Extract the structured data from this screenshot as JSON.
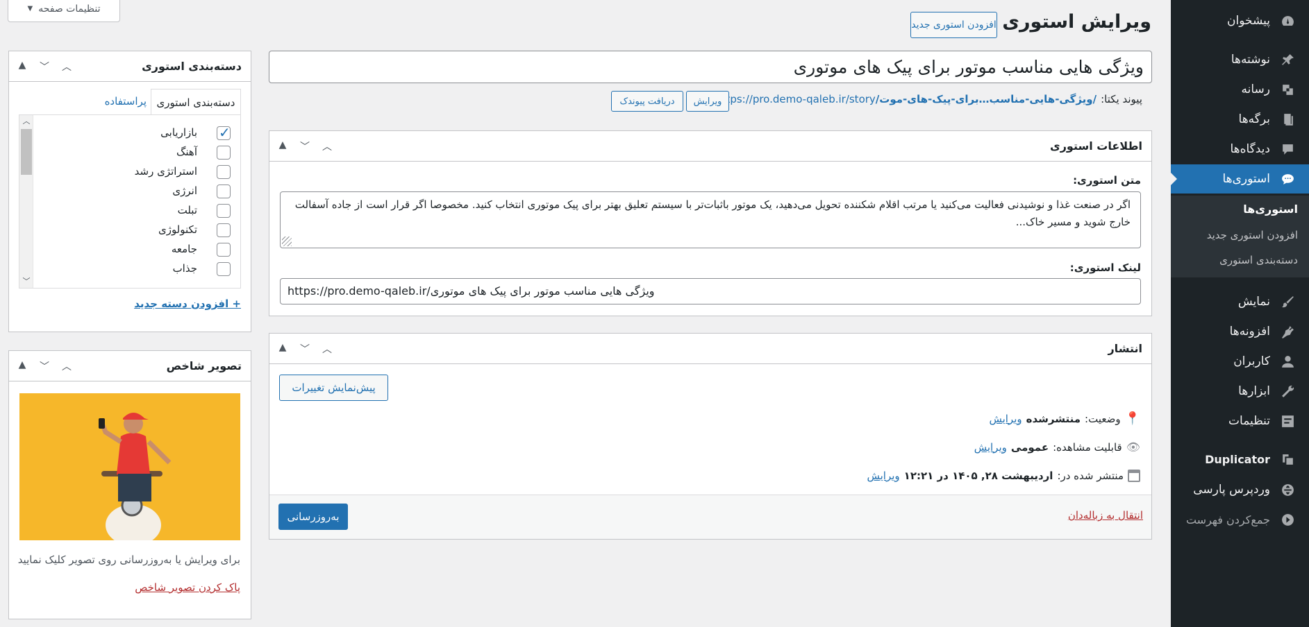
{
  "screen_options": "تنظیمات صفحه",
  "page_title": "ویرایش استوری",
  "add_new_button": "افزودن استوری جدید",
  "post_title": "ویژگی هایی مناسب موتور برای پیک های موتوری",
  "permalink": {
    "label": "پیوند یکتا:",
    "base": "https://pro.demo-qaleb.ir/story",
    "slug": "/ویژگی-هایی-مناسب…برای-پیک-های-موت/",
    "edit_button": "ویرایش",
    "get_link_button": "دریافت پیوندک"
  },
  "story_info": {
    "title": "اطلاعات استوری",
    "text_label": "متن استوری:",
    "text_value": "اگر در صنعت غذا و نوشیدنی فعالیت می‌کنید یا مرتب اقلام شکننده تحویل می‌دهید، یک موتور باثبات‌تر با سیستم تعلیق بهتر برای پیک موتوری انتخاب کنید. مخصوصا اگر قرار است از جاده آسفالت خارج شوید و مسیر خاک...",
    "link_label": "لینک استوری:",
    "link_value": "https://pro.demo-qaleb.ir/ویژگی هایی مناسب موتور برای پیک های موتوری"
  },
  "publish": {
    "title": "انتشار",
    "preview_button": "پیش‌نمایش تغییرات",
    "status_label": "وضعیت:",
    "status_value": "منتشرشده",
    "visibility_label": "قابلیت مشاهده:",
    "visibility_value": "عمومی",
    "published_label": "منتشر شده در:",
    "published_value": "اردیبهشت ۲۸, ۱۴۰۵ در ۱۲:۲۱",
    "edit_link": "ویرایش",
    "trash_link": "انتقال به زباله‌دان",
    "update_button": "به‌روزرسانی"
  },
  "categories": {
    "title": "دسته‌بندی استوری",
    "tab_all": "دسته‌بندی استوری",
    "tab_popular": "پراستفاده",
    "items": [
      {
        "label": "بازاریابی",
        "checked": true
      },
      {
        "label": "آهنگ",
        "checked": false
      },
      {
        "label": "استراتژی رشد",
        "checked": false
      },
      {
        "label": "انرژی",
        "checked": false
      },
      {
        "label": "تبلت",
        "checked": false
      },
      {
        "label": "تکنولوژی",
        "checked": false
      },
      {
        "label": "جامعه",
        "checked": false
      },
      {
        "label": "جذاب",
        "checked": false
      }
    ],
    "add_new": "+ افزودن دسته جدید"
  },
  "featured_image": {
    "title": "تصویر شاخص",
    "hint": "برای ویرایش یا به‌روزرسانی روی تصویر کلیک نمایید",
    "remove": "پاک کردن تصویر شاخص"
  },
  "sidebar": {
    "items": [
      {
        "label": "پیشخوان",
        "icon": "dashboard-icon"
      },
      {
        "label": "نوشته‌ها",
        "icon": "pin-icon"
      },
      {
        "label": "رسانه",
        "icon": "media-icon"
      },
      {
        "label": "برگه‌ها",
        "icon": "pages-icon"
      },
      {
        "label": "دیدگاه‌ها",
        "icon": "comments-icon"
      },
      {
        "label": "استوری‌ها",
        "icon": "chat-icon"
      },
      {
        "label": "نمایش",
        "icon": "brush-icon"
      },
      {
        "label": "افزونه‌ها",
        "icon": "plugin-icon"
      },
      {
        "label": "کاربران",
        "icon": "users-icon"
      },
      {
        "label": "ابزارها",
        "icon": "wrench-icon"
      },
      {
        "label": "تنظیمات",
        "icon": "settings-icon"
      },
      {
        "label": "Duplicator",
        "icon": "duplicator-icon"
      },
      {
        "label": "وردپرس پارسی",
        "icon": "globe-icon"
      },
      {
        "label": "جمع‌کردن فهرست",
        "icon": "collapse-icon"
      }
    ],
    "submenu": [
      "استوری‌ها",
      "افزودن استوری جدید",
      "دسته‌بندی استوری"
    ]
  },
  "colors": {
    "accent": "#2271b1",
    "sidebar": "#1d2327",
    "danger": "#b32d2e"
  }
}
